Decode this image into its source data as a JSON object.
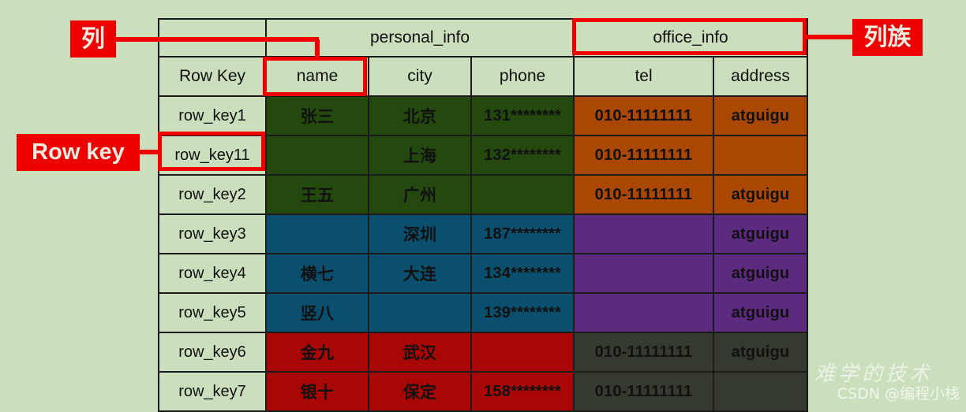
{
  "diagram": {
    "title": "HBase table structure illustration",
    "background_color": "#cbdfbd"
  },
  "annotations": {
    "column_label": "列",
    "row_key_label": "Row key",
    "column_family_label": "列族",
    "highlight_color": "#ee0000"
  },
  "table": {
    "family_header": {
      "spacer": "",
      "families": [
        {
          "name": "personal_info",
          "span": 3
        },
        {
          "name": "office_info",
          "span": 2,
          "highlighted": true
        }
      ]
    },
    "columns": [
      {
        "key": "row_key",
        "label": "Row Key",
        "highlighted": false
      },
      {
        "key": "name",
        "label": "name",
        "highlighted": true
      },
      {
        "key": "city",
        "label": "city",
        "highlighted": false
      },
      {
        "key": "phone",
        "label": "phone",
        "highlighted": false
      },
      {
        "key": "tel",
        "label": "tel",
        "highlighted": false
      },
      {
        "key": "address",
        "label": "address",
        "highlighted": false
      }
    ],
    "palette": {
      "green": "#23490f",
      "orange": "#a94703",
      "teal": "#0a4f6e",
      "purple": "#5c2a7e",
      "red": "#a90606",
      "gray": "#343a2e",
      "rowkey_bg": "#cbdfbd",
      "border": "#1b1b1b",
      "value_text": "#e9e9d2"
    },
    "rows": [
      {
        "row_key": "row_key1",
        "highlighted": false,
        "personal_color": "green",
        "office_color": "orange",
        "name": "张三",
        "city": "北京",
        "phone": "131********",
        "tel": "010-11111111",
        "address": "atguigu"
      },
      {
        "row_key": "row_key11",
        "highlighted": true,
        "personal_color": "green",
        "office_color": "orange",
        "name": "",
        "city": "上海",
        "phone": "132********",
        "tel": "010-11111111",
        "address": ""
      },
      {
        "row_key": "row_key2",
        "highlighted": false,
        "personal_color": "green",
        "office_color": "orange",
        "name": "王五",
        "city": "广州",
        "phone": "",
        "tel": "010-11111111",
        "address": "atguigu"
      },
      {
        "row_key": "row_key3",
        "highlighted": false,
        "personal_color": "teal",
        "office_color": "purple",
        "name": "",
        "city": "深圳",
        "phone": "187********",
        "tel": "",
        "address": "atguigu"
      },
      {
        "row_key": "row_key4",
        "highlighted": false,
        "personal_color": "teal",
        "office_color": "purple",
        "name": "横七",
        "city": "大连",
        "phone": "134********",
        "tel": "",
        "address": "atguigu"
      },
      {
        "row_key": "row_key5",
        "highlighted": false,
        "personal_color": "teal",
        "office_color": "purple",
        "name": "竖八",
        "city": "",
        "phone": "139********",
        "tel": "",
        "address": "atguigu"
      },
      {
        "row_key": "row_key6",
        "highlighted": false,
        "personal_color": "red",
        "office_color": "gray",
        "name": "金九",
        "city": "武汉",
        "phone": "",
        "tel": "010-11111111",
        "address": "atguigu"
      },
      {
        "row_key": "row_key7",
        "highlighted": false,
        "personal_color": "red",
        "office_color": "gray",
        "name": "银十",
        "city": "保定",
        "phone": "158********",
        "tel": "010-11111111",
        "address": ""
      }
    ]
  },
  "watermark": {
    "script_text": "难学的技术",
    "credit_text": "CSDN @编程小栈"
  }
}
